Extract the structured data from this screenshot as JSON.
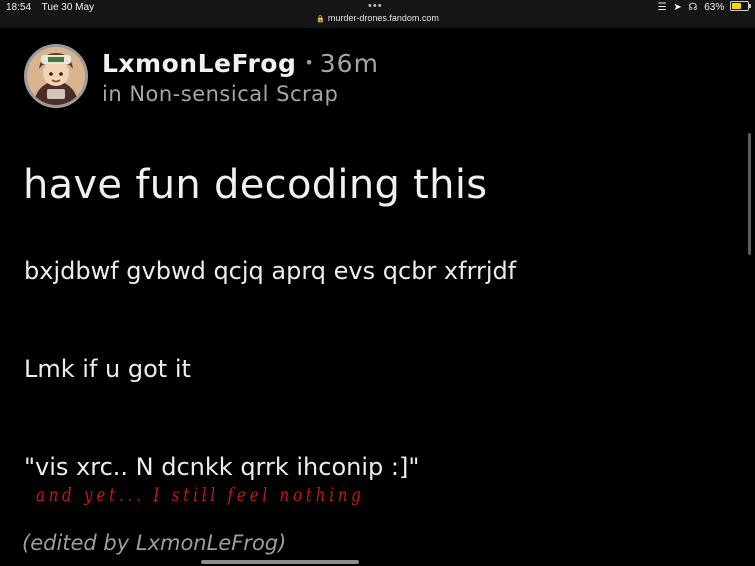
{
  "status_bar": {
    "time": "18:54",
    "date": "Tue 30 May",
    "url": "murder-drones.fandom.com",
    "battery_percent_label": "63%",
    "battery_level": 0.63,
    "battery_color": "#ffd60a"
  },
  "post": {
    "author": "LxmonLeFrog",
    "time_ago": "36m",
    "community": "in Non-sensical Scrap",
    "title": "have fun decoding this",
    "body": [
      "bxjdbwf gvbwd qcjq aprq evs qcbr xfrrjdf",
      "Lmk if u got it",
      "\"vis xrc.. N dcnkk qrrk ihconip :]\""
    ],
    "annotation": "and yet... I still feel nothing",
    "annotation_color": "#c11a1a",
    "edited_note": "(edited by LxmonLeFrog)"
  }
}
